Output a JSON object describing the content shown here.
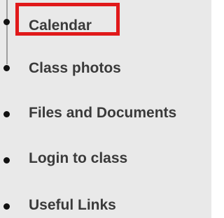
{
  "nav": {
    "items": [
      {
        "label": "Calendar",
        "name": "nav-item-calendar"
      },
      {
        "label": "Class photos",
        "name": "nav-item-class-photos"
      },
      {
        "label": "Files and Documents",
        "name": "nav-item-files-and-documents"
      },
      {
        "label": "Login to class",
        "name": "nav-item-login-to-class"
      },
      {
        "label": "Useful Links",
        "name": "nav-item-useful-links"
      }
    ]
  },
  "colors": {
    "highlight": "#e0191a",
    "panel_background": "#e9e9e9",
    "text": "#3a3a3a"
  }
}
